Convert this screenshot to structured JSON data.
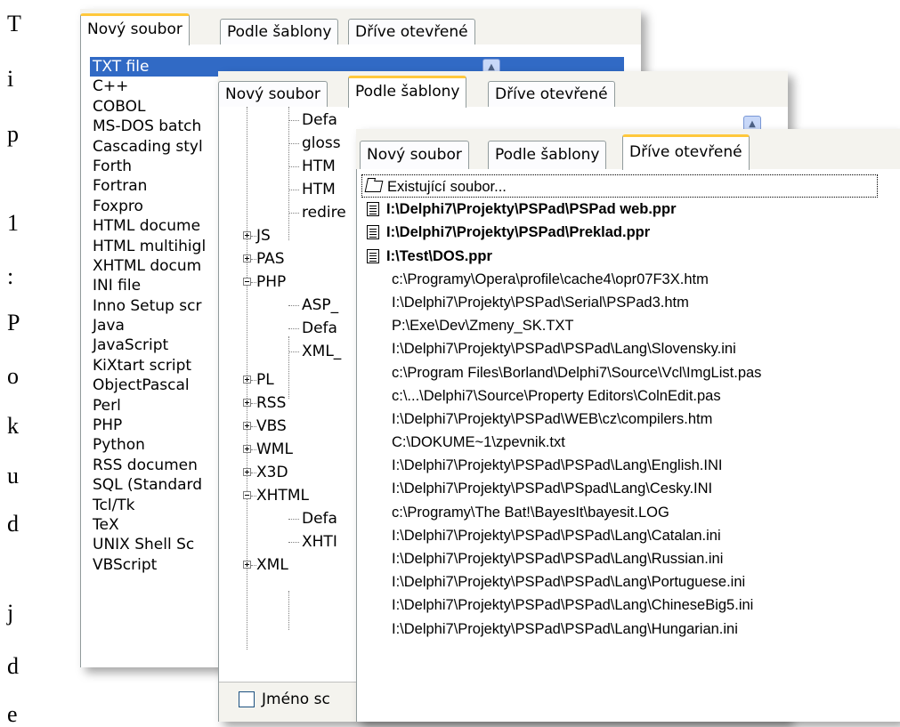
{
  "side_text": [
    "T",
    "i",
    "p",
    "1",
    ":",
    "P",
    "o",
    "k",
    "u",
    "d",
    "j",
    "d",
    "e"
  ],
  "tabs": {
    "new_file": "Nový soubor",
    "by_template": "Podle šablony",
    "recently_opened": "Dříve otevřené"
  },
  "new_file_list": [
    "TXT file",
    "C++",
    "COBOL",
    "MS-DOS batch",
    "Cascading styl",
    "Forth",
    "Fortran",
    "Foxpro",
    "HTML docume",
    "HTML multihigl",
    "XHTML docum",
    "INI file",
    "Inno Setup scr",
    "Java",
    "JavaScript",
    "KiXtart script",
    "ObjectPascal",
    "Perl",
    "PHP",
    "Python",
    "RSS documen",
    "SQL (Standard",
    "Tcl/Tk",
    "TeX",
    "UNIX Shell Sc",
    "VBScript"
  ],
  "template_tree": {
    "top_leaves": [
      "Defa",
      "gloss",
      "HTM",
      "HTM",
      "redire"
    ],
    "js": "JS",
    "pas": "PAS",
    "php": "PHP",
    "php_children": [
      "ASP_",
      "Defa",
      "XML_"
    ],
    "pl": "PL",
    "rss": "RSS",
    "vbs": "VBS",
    "wml": "WML",
    "x3d": "X3D",
    "xhtml": "XHTML",
    "xhtml_children": [
      "Defa",
      "XHTI"
    ],
    "xml": "XML",
    "checkbox_label": "Jméno sc"
  },
  "recent": {
    "open_existing": "Existující soubor...",
    "projects": [
      "I:\\Delphi7\\Projekty\\PSPad\\PSPad web.ppr",
      "I:\\Delphi7\\Projekty\\PSPad\\Preklad.ppr",
      "I:\\Test\\DOS.ppr"
    ],
    "files": [
      "c:\\Programy\\Opera\\profile\\cache4\\opr07F3X.htm",
      "I:\\Delphi7\\Projekty\\PSPad\\Serial\\PSPad3.htm",
      "P:\\Exe\\Dev\\Zmeny_SK.TXT",
      "I:\\Delphi7\\Projekty\\PSPad\\PSPad\\Lang\\Slovensky.ini",
      "c:\\Program Files\\Borland\\Delphi7\\Source\\Vcl\\ImgList.pas",
      "c:\\...\\Delphi7\\Source\\Property Editors\\ColnEdit.pas",
      "I:\\Delphi7\\Projekty\\PSPad\\WEB\\cz\\compilers.htm",
      "C:\\DOKUME~1\\zpevnik.txt",
      "I:\\Delphi7\\Projekty\\PSPad\\PSPad\\Lang\\English.INI",
      "I:\\Delphi7\\Projekty\\PSPad\\PSpad\\Lang\\Cesky.INI",
      "c:\\Programy\\The Bat!\\BayesIt\\bayesit.LOG",
      "I:\\Delphi7\\Projekty\\PSPad\\PSPad\\Lang\\Catalan.ini",
      "I:\\Delphi7\\Projekty\\PSPad\\PSPad\\Lang\\Russian.ini",
      "I:\\Delphi7\\Projekty\\PSPad\\PSPad\\Lang\\Portuguese.ini",
      "I:\\Delphi7\\Projekty\\PSPad\\PSPad\\Lang\\ChineseBig5.ini",
      "I:\\Delphi7\\Projekty\\PSPad\\PSPad\\Lang\\Hungarian.ini"
    ]
  }
}
